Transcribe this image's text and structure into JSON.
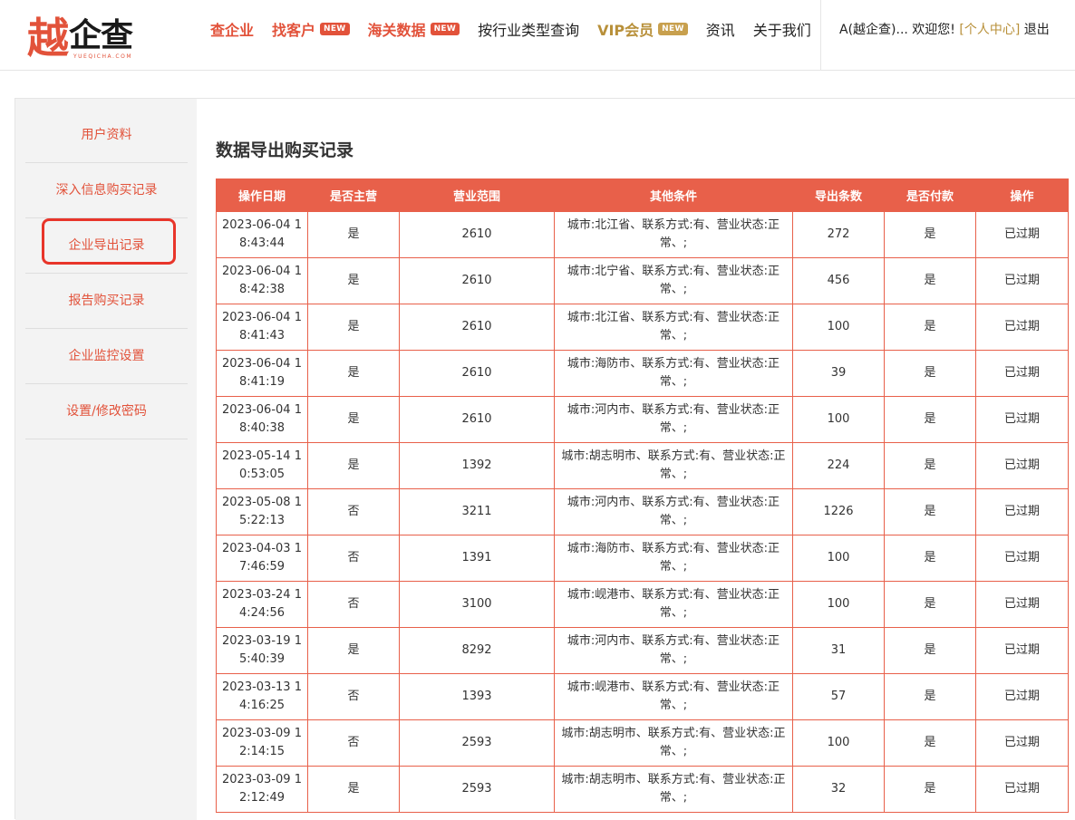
{
  "logo": {
    "main": "越",
    "rest": "企查",
    "sub": "YUEQICHA.COM"
  },
  "nav": [
    {
      "label": "查企业",
      "style": "red",
      "badge": ""
    },
    {
      "label": "找客户",
      "style": "red",
      "badge": "NEW"
    },
    {
      "label": "海关数据",
      "style": "red",
      "badge": "NEW"
    },
    {
      "label": "按行业类型查询",
      "style": "plain",
      "badge": ""
    },
    {
      "label": "VIP会员",
      "style": "gold",
      "badge": "NEW"
    },
    {
      "label": "资讯",
      "style": "plain",
      "badge": ""
    },
    {
      "label": "关于我们",
      "style": "plain",
      "badge": ""
    }
  ],
  "user": {
    "greeting": "A(越企查)... 欢迎您!",
    "center": "[个人中心]",
    "logout": "退出"
  },
  "sidebar": {
    "items": [
      {
        "label": "用户资料"
      },
      {
        "label": "深入信息购买记录"
      },
      {
        "label": "企业导出记录"
      },
      {
        "label": "报告购买记录"
      },
      {
        "label": "企业监控设置"
      },
      {
        "label": "设置/修改密码"
      }
    ],
    "active_index": 2
  },
  "page_title": "数据导出购买记录",
  "table": {
    "columns": [
      "操作日期",
      "是否主营",
      "营业范围",
      "其他条件",
      "导出条数",
      "是否付款",
      "操作"
    ],
    "rows": [
      [
        "2023-06-04 18:43:44",
        "是",
        "2610",
        "城市:北江省、联系方式:有、营业状态:正常、;",
        "272",
        "是",
        "已过期"
      ],
      [
        "2023-06-04 18:42:38",
        "是",
        "2610",
        "城市:北宁省、联系方式:有、营业状态:正常、;",
        "456",
        "是",
        "已过期"
      ],
      [
        "2023-06-04 18:41:43",
        "是",
        "2610",
        "城市:北江省、联系方式:有、营业状态:正常、;",
        "100",
        "是",
        "已过期"
      ],
      [
        "2023-06-04 18:41:19",
        "是",
        "2610",
        "城市:海防市、联系方式:有、营业状态:正常、;",
        "39",
        "是",
        "已过期"
      ],
      [
        "2023-06-04 18:40:38",
        "是",
        "2610",
        "城市:河内市、联系方式:有、营业状态:正常、;",
        "100",
        "是",
        "已过期"
      ],
      [
        "2023-05-14 10:53:05",
        "是",
        "1392",
        "城市:胡志明市、联系方式:有、营业状态:正常、;",
        "224",
        "是",
        "已过期"
      ],
      [
        "2023-05-08 15:22:13",
        "否",
        "3211",
        "城市:河内市、联系方式:有、营业状态:正常、;",
        "1226",
        "是",
        "已过期"
      ],
      [
        "2023-04-03 17:46:59",
        "否",
        "1391",
        "城市:海防市、联系方式:有、营业状态:正常、;",
        "100",
        "是",
        "已过期"
      ],
      [
        "2023-03-24 14:24:56",
        "否",
        "3100",
        "城市:岘港市、联系方式:有、营业状态:正常、;",
        "100",
        "是",
        "已过期"
      ],
      [
        "2023-03-19 15:40:39",
        "是",
        "8292",
        "城市:河内市、联系方式:有、营业状态:正常、;",
        "31",
        "是",
        "已过期"
      ],
      [
        "2023-03-13 14:16:25",
        "否",
        "1393",
        "城市:岘港市、联系方式:有、营业状态:正常、;",
        "57",
        "是",
        "已过期"
      ],
      [
        "2023-03-09 12:14:15",
        "否",
        "2593",
        "城市:胡志明市、联系方式:有、营业状态:正常、;",
        "100",
        "是",
        "已过期"
      ],
      [
        "2023-03-09 12:12:49",
        "是",
        "2593",
        "城市:胡志明市、联系方式:有、营业状态:正常、;",
        "32",
        "是",
        "已过期"
      ]
    ]
  }
}
